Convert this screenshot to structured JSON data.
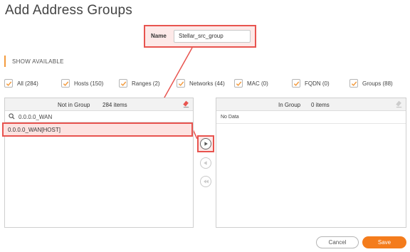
{
  "dialog": {
    "title": "Add Address Groups"
  },
  "name_field": {
    "label": "Name",
    "value": "Stellar_src_group"
  },
  "show_available": {
    "label": "SHOW AVAILABLE"
  },
  "filters": [
    {
      "label": "All (284)",
      "checked": true
    },
    {
      "label": "Hosts (150)",
      "checked": true
    },
    {
      "label": "Ranges (2)",
      "checked": true
    },
    {
      "label": "Networks (44)",
      "checked": true
    },
    {
      "label": "MAC (0)",
      "checked": true
    },
    {
      "label": "FQDN (0)",
      "checked": true
    },
    {
      "label": "Groups (88)",
      "checked": true
    }
  ],
  "left_panel": {
    "title": "Not in Group",
    "count": "284 items",
    "search_value": "0.0.0.0_WAN",
    "items": [
      "0.0.0.0_WAN[HOST]"
    ]
  },
  "right_panel": {
    "title": "In Group",
    "count": "0 items",
    "empty_text": "No Data"
  },
  "buttons": {
    "cancel": "Cancel",
    "save": "Save"
  },
  "colors": {
    "highlight": "#e8544f",
    "accent": "#f47c1c",
    "check": "#f39a3d"
  }
}
